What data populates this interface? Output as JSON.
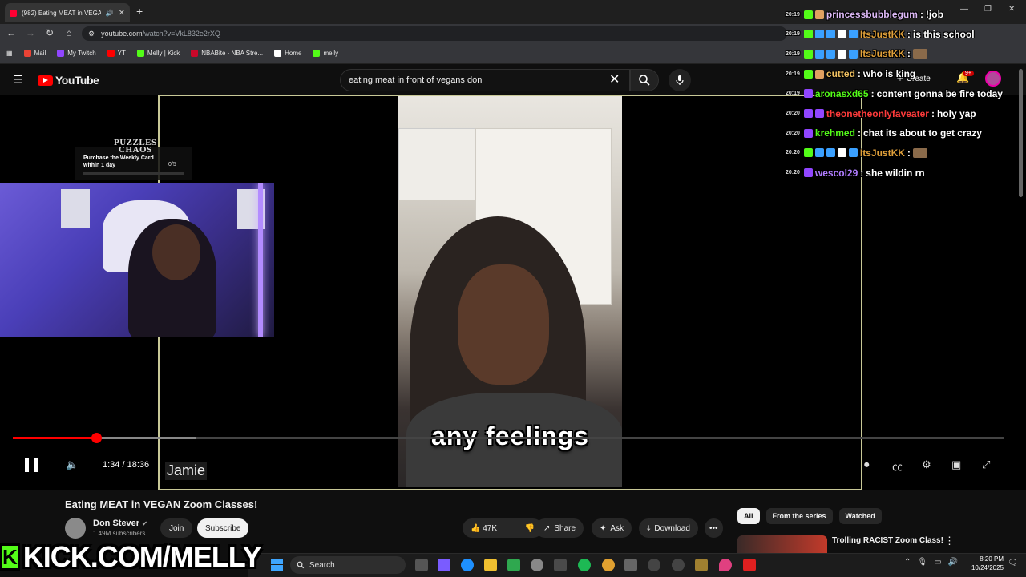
{
  "browser": {
    "tab_title": "(982) Eating MEAT in VEGAN",
    "tab_close": "✕",
    "new_tab": "+",
    "url_host": "youtube.com",
    "url_path": "/watch?v=VkL832e2rXQ",
    "window_controls": [
      "—",
      "❐",
      "✕"
    ],
    "bookmarks": [
      {
        "label": "Mail",
        "color": "#ea4335"
      },
      {
        "label": "My Twitch",
        "color": "#9146ff"
      },
      {
        "label": "YT",
        "color": "#ff0000"
      },
      {
        "label": "Melly | Kick",
        "color": "#53fc18"
      },
      {
        "label": "NBABite - NBA Stre...",
        "color": "#c9082a"
      },
      {
        "label": "Home",
        "color": "#ffffff"
      },
      {
        "label": "melly",
        "color": "#53fc18"
      }
    ]
  },
  "youtube": {
    "logo_text": "YouTube",
    "search_value": "eating meat in front of vegans don",
    "create_label": "Create",
    "notif_count": "9+",
    "player": {
      "subtitle": "any feelings",
      "name_tag": "Jamie",
      "time": "1:34 / 18:36",
      "progress_fraction": 0.084
    },
    "video": {
      "title": "Eating MEAT in VEGAN Zoom Classes!",
      "channel": "Don Stever",
      "verified": "✔",
      "subscribers": "1.49M subscribers",
      "join_label": "Join",
      "subscribe_label": "Subscribe",
      "likes": "47K",
      "share_label": "Share",
      "ask_label": "Ask",
      "download_label": "Download",
      "more": "•••"
    },
    "chips": [
      "All",
      "From the series",
      "Watched"
    ],
    "recommended": {
      "title": "Trolling RACIST Zoom Class!",
      "more": "⋮"
    }
  },
  "overlay": {
    "puzzles_logo_line1": "PUZZLES",
    "puzzles_logo_line2": "CHAOS",
    "puzzles_task": "Purchase the Weekly Card within 1 day",
    "puzzles_count": "0/5",
    "kick_banner": "KICK.COM/MELLY",
    "kick_letter": "K"
  },
  "chat": [
    {
      "ts": "20:19",
      "user": "princessbubblegum",
      "color": "#dcb8f5",
      "msg": "!job",
      "badges": [
        "#53fc18",
        "#e0a060"
      ]
    },
    {
      "ts": "20:19",
      "user": "ItsJustKK",
      "color": "#e0a03a",
      "msg": "is this school",
      "badges": [
        "#53fc18",
        "#3aa0ff",
        "#3aa0ff",
        "#ffffff",
        "#3aa0ff"
      ]
    },
    {
      "ts": "20:19",
      "user": "ItsJustKK",
      "color": "#e0a03a",
      "msg": "",
      "badges": [
        "#53fc18",
        "#3aa0ff",
        "#3aa0ff",
        "#ffffff",
        "#3aa0ff"
      ]
    },
    {
      "ts": "20:19",
      "user": "cutted",
      "color": "#f0c060",
      "msg": "who is king",
      "badges": [
        "#53fc18",
        "#e0a060"
      ]
    },
    {
      "ts": "20:19",
      "user": "aronasxd65",
      "color": "#53fc18",
      "msg": "content gonna be fire today",
      "badges": [
        "#9146ff"
      ]
    },
    {
      "ts": "20:20",
      "user": "theonetheonlyfaveater",
      "color": "#ff3b3b",
      "msg": "holy yap",
      "badges": [
        "#9146ff",
        "#9146ff"
      ]
    },
    {
      "ts": "20:20",
      "user": "krehmed",
      "color": "#53fc18",
      "msg": "chat its about to get crazy",
      "badges": [
        "#9146ff"
      ]
    },
    {
      "ts": "20:20",
      "user": "ItsJustKK",
      "color": "#e0a03a",
      "msg": "",
      "badges": [
        "#53fc18",
        "#3aa0ff",
        "#3aa0ff",
        "#ffffff",
        "#3aa0ff"
      ]
    },
    {
      "ts": "20:20",
      "user": "wescol29",
      "color": "#b07cff",
      "msg": "she wildin rn",
      "badges": [
        "#9146ff"
      ]
    }
  ],
  "taskbar": {
    "search_label": "Search",
    "time": "8:20 PM",
    "date": "10/24/2025"
  }
}
